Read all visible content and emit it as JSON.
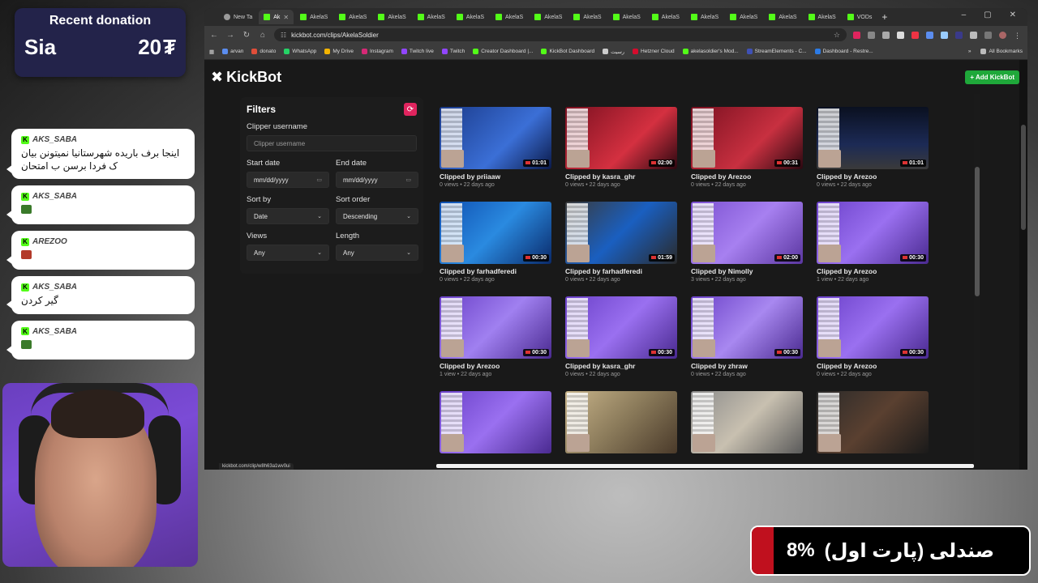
{
  "donation": {
    "title": "Recent donation",
    "name": "Sia",
    "amount": "20",
    "currency_symbol": "₮"
  },
  "chat": [
    {
      "user": "AKS_SABA",
      "text": "اینجا برف باریده شهرستانیا نمیتونن بیان ک فردا برسن ب امتحان",
      "emote": null
    },
    {
      "user": "AKS_SABA",
      "text": "",
      "emote": "#3a7a2a"
    },
    {
      "user": "AREZOO",
      "text": "",
      "emote": "#b33a2a"
    },
    {
      "user": "AKS_SABA",
      "text": "گیر کردن",
      "emote": null
    },
    {
      "user": "AKS_SABA",
      "text": "",
      "emote": "#3a7a2a"
    }
  ],
  "progress": {
    "label": "صندلی (پارت اول)",
    "percent_text": "8%",
    "fraction": 0.08,
    "color": "#c0101e"
  },
  "browser": {
    "tabs": [
      {
        "label": "New Ta",
        "icon": "globe-icon",
        "active": false
      },
      {
        "label": "Ak",
        "icon": "kick-icon",
        "active": true
      },
      {
        "label": "AkelaS",
        "icon": "kick-icon",
        "active": false
      },
      {
        "label": "AkelaS",
        "icon": "kick-icon",
        "active": false
      },
      {
        "label": "AkelaS",
        "icon": "kick-icon",
        "active": false
      },
      {
        "label": "AkelaS",
        "icon": "kick-icon",
        "active": false
      },
      {
        "label": "AkelaS",
        "icon": "kick-icon",
        "active": false
      },
      {
        "label": "AkelaS",
        "icon": "kick-icon",
        "active": false
      },
      {
        "label": "AkelaS",
        "icon": "kick-icon",
        "active": false
      },
      {
        "label": "AkelaS",
        "icon": "kick-icon",
        "active": false
      },
      {
        "label": "AkelaS",
        "icon": "kick-icon",
        "active": false
      },
      {
        "label": "AkelaS",
        "icon": "kick-icon",
        "active": false
      },
      {
        "label": "AkelaS",
        "icon": "kick-icon",
        "active": false
      },
      {
        "label": "AkelaS",
        "icon": "kick-icon",
        "active": false
      },
      {
        "label": "AkelaS",
        "icon": "kick-icon",
        "active": false
      },
      {
        "label": "AkelaS",
        "icon": "kick-icon",
        "active": false
      },
      {
        "label": "VODs",
        "icon": "kick-icon",
        "active": false
      }
    ],
    "url": "kickbot.com/clips/AkelaSoldier",
    "bookmarks": [
      {
        "label": "arvan",
        "color": "#5b8def"
      },
      {
        "label": "donato",
        "color": "#e04e39"
      },
      {
        "label": "WhatsApp",
        "color": "#25d366"
      },
      {
        "label": "My Drive",
        "color": "#f4b400"
      },
      {
        "label": "Instagram",
        "color": "#d62976"
      },
      {
        "label": "Twitch live",
        "color": "#9146ff"
      },
      {
        "label": "Twitch",
        "color": "#9146ff"
      },
      {
        "label": "Creator Dashboard |...",
        "color": "#53fc18"
      },
      {
        "label": "KickBot Dashboard",
        "color": "#53fc18"
      },
      {
        "label": "رسیت",
        "color": "#cccccc"
      },
      {
        "label": "Hetzner Cloud",
        "color": "#d50c2d"
      },
      {
        "label": "akelasoldier's Mod...",
        "color": "#53fc18"
      },
      {
        "label": "StreamElements - C...",
        "color": "#3f51b5"
      },
      {
        "label": "Dashboard - Restre...",
        "color": "#2c7be5"
      }
    ],
    "bookmarks_more": "»",
    "all_bookmarks": "All Bookmarks",
    "status_url": "kickbot.com/clip/w8h63a1wv0ui"
  },
  "kickbot": {
    "logo": "KickBot",
    "add_button": "+ Add KickBot",
    "filters": {
      "title": "Filters",
      "clipper_label": "Clipper username",
      "clipper_placeholder": "Clipper username",
      "start_label": "Start date",
      "start_placeholder": "mm/dd/yyyy",
      "end_label": "End date",
      "end_placeholder": "mm/dd/yyyy",
      "sort_by_label": "Sort by",
      "sort_by_value": "Date",
      "sort_order_label": "Sort order",
      "sort_order_value": "Descending",
      "views_label": "Views",
      "views_value": "Any",
      "length_label": "Length",
      "length_value": "Any"
    },
    "clips": [
      [
        {
          "by": "Clipped by priiaaw",
          "meta": "0 views • 22 days ago",
          "duration": "01:01",
          "bg": "linear-gradient(135deg,#1a3a8a,#3b6fd6 60%,#0b1a4a)"
        },
        {
          "by": "Clipped by kasra_ghr",
          "meta": "0 views • 22 days ago",
          "duration": "02:00",
          "bg": "linear-gradient(135deg,#7a1020,#d43040 60%,#2a0810)"
        },
        {
          "by": "Clipped by Arezoo",
          "meta": "0 views • 22 days ago",
          "duration": "00:31",
          "bg": "linear-gradient(135deg,#7a1020,#c83040 60%,#2a0810)"
        },
        {
          "by": "Clipped by Arezoo",
          "meta": "0 views • 22 days ago",
          "duration": "01:01",
          "bg": "linear-gradient(180deg,#0a1020,#1c2a55 60%,#3a3a3a)"
        }
      ],
      [
        {
          "by": "Clipped by farhadferedi",
          "meta": "0 views • 22 days ago",
          "duration": "00:30",
          "bg": "linear-gradient(135deg,#0f4fb0,#2a8ae0 50%,#0a2a6a)"
        },
        {
          "by": "Clipped by farhadferedi",
          "meta": "0 views • 22 days ago",
          "duration": "01:59",
          "bg": "linear-gradient(135deg,#3a3a3a,#1a5fc0 50%,#2a2a2a)"
        },
        {
          "by": "Clipped by Nimolly",
          "meta": "3 views • 22 days ago",
          "duration": "02:00",
          "bg": "linear-gradient(135deg,#7a4fd0,#a780f0 50%,#5a36a0)"
        },
        {
          "by": "Clipped by Arezoo",
          "meta": "1 view • 22 days ago",
          "duration": "00:30",
          "bg": "linear-gradient(135deg,#6a40c8,#9a70f0 50%,#4a2a90)"
        }
      ],
      [
        {
          "by": "Clipped by Arezoo",
          "meta": "1 view • 22 days ago",
          "duration": "00:30",
          "bg": "linear-gradient(135deg,#6a40c8,#a080f0 50%,#4a2a90)"
        },
        {
          "by": "Clipped by kasra_ghr",
          "meta": "0 views • 22 days ago",
          "duration": "00:30",
          "bg": "linear-gradient(135deg,#6a40c8,#9a70f0 50%,#4a2a90)"
        },
        {
          "by": "Clipped by zhraw",
          "meta": "0 views • 22 days ago",
          "duration": "00:30",
          "bg": "linear-gradient(135deg,#6a40c8,#a888f0 50%,#4a2a90)"
        },
        {
          "by": "Clipped by Arezoo",
          "meta": "0 views • 22 days ago",
          "duration": "00:30",
          "bg": "linear-gradient(135deg,#6a40c8,#9a70f0 50%,#4a2a90)"
        }
      ],
      [
        {
          "by": "",
          "meta": "",
          "duration": "",
          "bg": "linear-gradient(135deg,#6a40c8,#9a70f0 50%,#4a2a90)"
        },
        {
          "by": "",
          "meta": "",
          "duration": "",
          "bg": "linear-gradient(135deg,#c8b48a,#8a7a5a 50%,#4a3a2a)"
        },
        {
          "by": "",
          "meta": "",
          "duration": "",
          "bg": "linear-gradient(135deg,#8a8a8a,#c8c0b0 50%,#5a5a5a)"
        },
        {
          "by": "",
          "meta": "",
          "duration": "",
          "bg": "linear-gradient(135deg,#2a2a2a,#5a4030 50%,#1a1a1a)"
        }
      ]
    ]
  }
}
